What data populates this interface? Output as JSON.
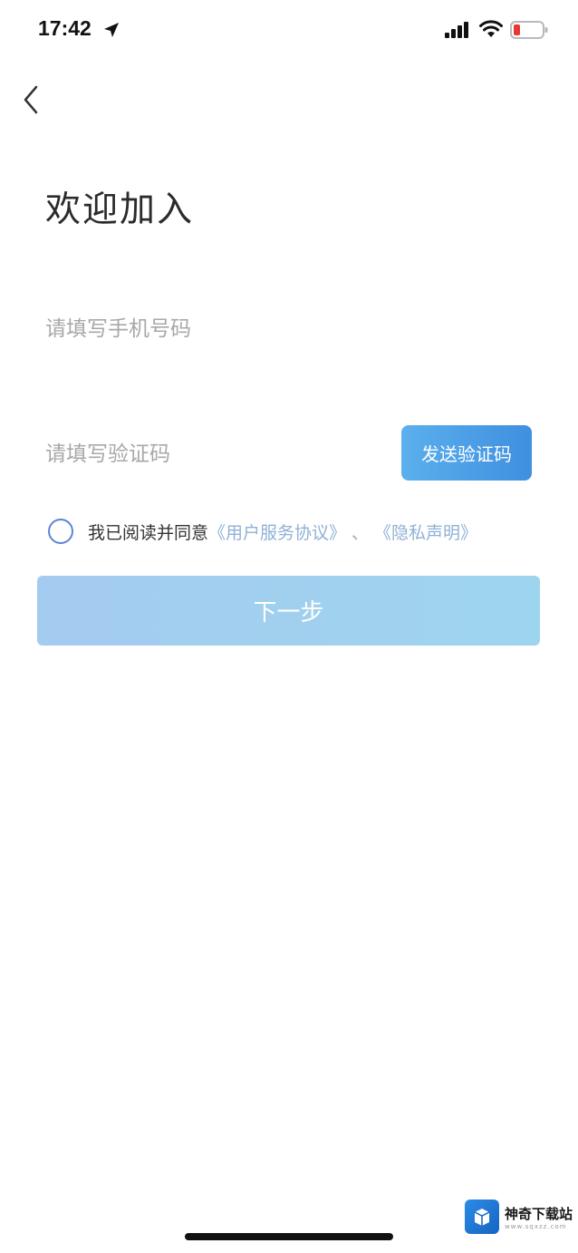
{
  "status_bar": {
    "time": "17:42",
    "icons": [
      "location-arrow-icon",
      "signal-icon",
      "wifi-icon",
      "battery-icon"
    ]
  },
  "page": {
    "title": "欢迎加入"
  },
  "form": {
    "phone_placeholder": "请填写手机号码",
    "code_placeholder": "请填写验证码",
    "send_code_label": "发送验证码"
  },
  "agreement": {
    "prefix": "我已阅读并同意",
    "user_agreement": "《用户服务协议》",
    "separator": "、",
    "privacy": "《隐私声明》"
  },
  "next_button_label": "下一步",
  "watermark": {
    "text": "神奇下载站",
    "sub": "www.sqxzz.com"
  },
  "colors": {
    "accent": "#3f8fe0",
    "next_button": "#a4cbf0",
    "link": "#8fb1d6",
    "radio": "#5b86d6"
  }
}
